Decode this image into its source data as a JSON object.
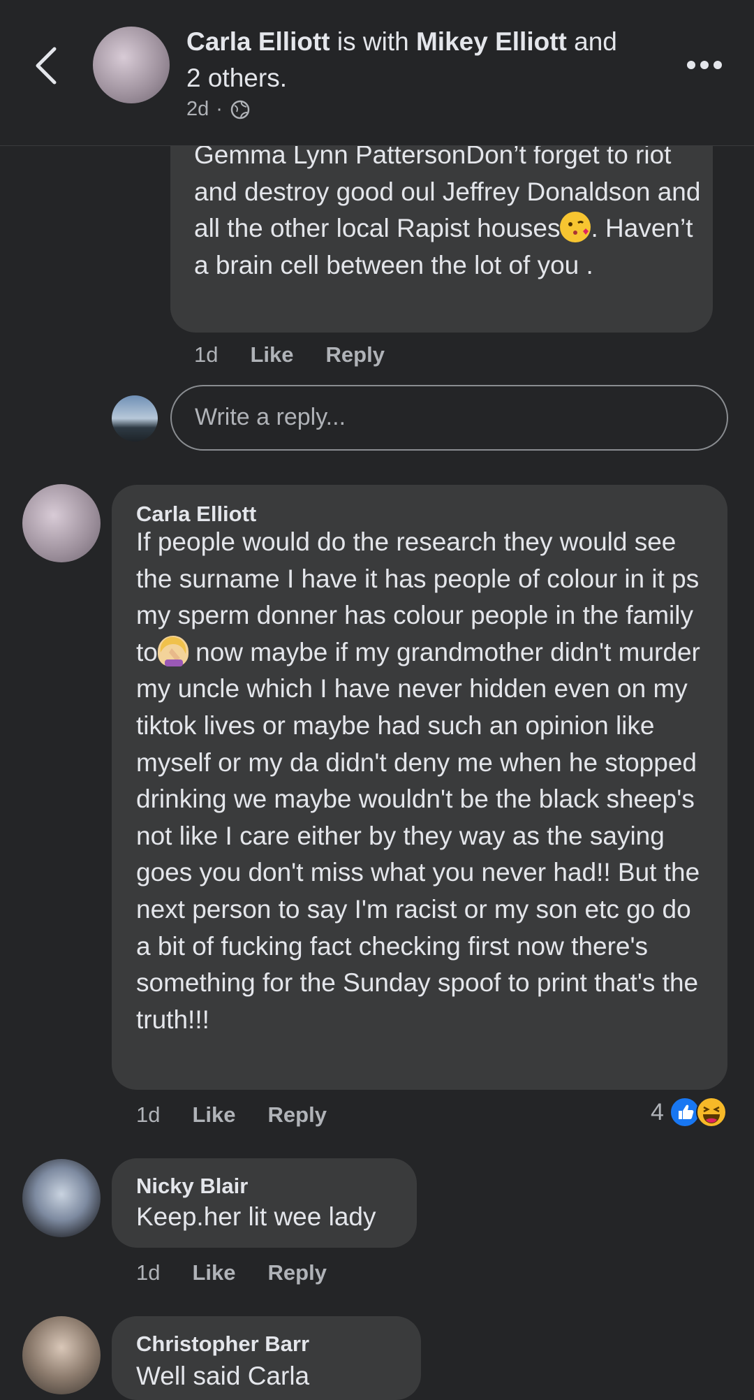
{
  "header": {
    "author": "Carla Elliott",
    "with_text": "is with",
    "tagged": "Mikey Elliott",
    "and_text": "and",
    "others": "2 others.",
    "time": "2d",
    "separator": "·"
  },
  "comments": [
    {
      "text_before": "Gemma Lynn PattersonDon’t forget to riot and destroy good oul Jeffrey Donaldson and all the other local Rapist houses",
      "emoji": "kissing-face-emoji",
      "text_after": ". Haven’t a brain cell between the lot of you .",
      "time": "1d",
      "like": "Like",
      "reply": "Reply"
    },
    {
      "name": "Carla Elliott",
      "text_before": "If people would do the research they would see the surname I have it has people of colour in it ps my sperm donner has colour people in the family to",
      "emoji": "facepalm-emoji",
      "text_after": " now maybe if my grandmother didn't murder my uncle which I have never hidden even on my tiktok lives or maybe had such an opinion like myself or my da didn't deny me when he stopped drinking we maybe wouldn't be the black sheep's not like I care either by they way as the saying goes you don't miss what you never had!! But the next person to say I'm racist or my son etc go do a bit of fucking fact checking first now there's something for the Sunday spoof to print that's the truth!!!",
      "time": "1d",
      "like": "Like",
      "reply": "Reply",
      "reaction_count": "4"
    },
    {
      "name": "Nicky Blair",
      "text": "Keep.her lit wee lady",
      "time": "1d",
      "like": "Like",
      "reply": "Reply"
    },
    {
      "name": "Christopher Barr",
      "text": "Well said Carla"
    }
  ],
  "reply_input": {
    "placeholder": "Write a reply..."
  },
  "colors": {
    "like_blue": "#1877f2",
    "haha_yellow": "#f7b928",
    "bubble": "#3a3b3c",
    "background": "#242527"
  }
}
